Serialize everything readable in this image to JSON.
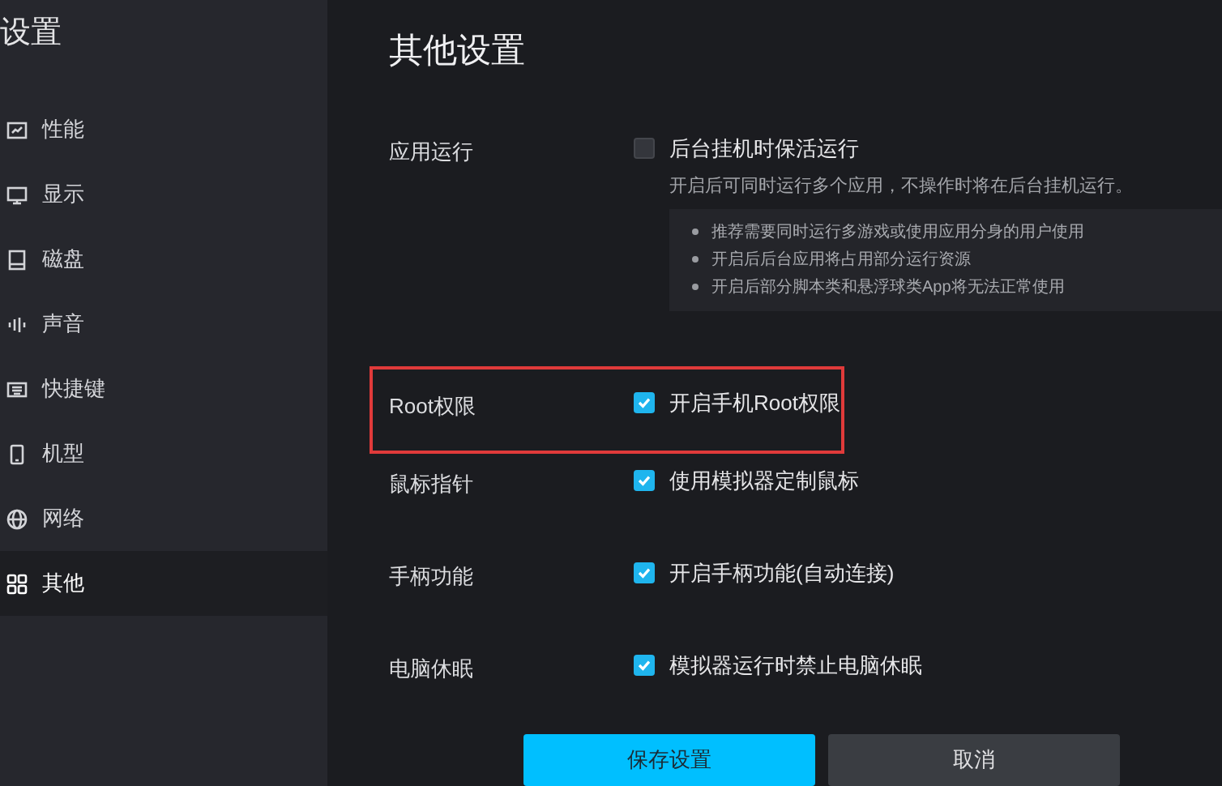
{
  "sidebar": {
    "title": "设置",
    "items": [
      {
        "label": "性能",
        "selected": false
      },
      {
        "label": "显示",
        "selected": false
      },
      {
        "label": "磁盘",
        "selected": false
      },
      {
        "label": "声音",
        "selected": false
      },
      {
        "label": "快捷键",
        "selected": false
      },
      {
        "label": "机型",
        "selected": false
      },
      {
        "label": "网络",
        "selected": false
      },
      {
        "label": "其他",
        "selected": true
      }
    ]
  },
  "page_title": "其他设置",
  "settings": [
    {
      "label": "应用运行",
      "option": "后台挂机时保活运行",
      "checked": false,
      "highlighted": false,
      "description": "开启后可同时运行多个应用，不操作时将在后台挂机运行。",
      "notes": [
        "推荐需要同时运行多游戏或使用应用分身的用户使用",
        "开启后后台应用将占用部分运行资源",
        "开启后部分脚本类和悬浮球类App将无法正常使用"
      ]
    },
    {
      "label": "Root权限",
      "option": "开启手机Root权限",
      "checked": true,
      "highlighted": true
    },
    {
      "label": "鼠标指针",
      "option": "使用模拟器定制鼠标",
      "checked": true,
      "highlighted": false
    },
    {
      "label": "手柄功能",
      "option": "开启手柄功能(自动连接)",
      "checked": true,
      "highlighted": false
    },
    {
      "label": "电脑休眠",
      "option": "模拟器运行时禁止电脑休眠",
      "checked": true,
      "highlighted": false
    }
  ],
  "buttons": [
    {
      "label": "保存设置",
      "kind": "primary"
    },
    {
      "label": "取消",
      "kind": "secondary"
    }
  ]
}
